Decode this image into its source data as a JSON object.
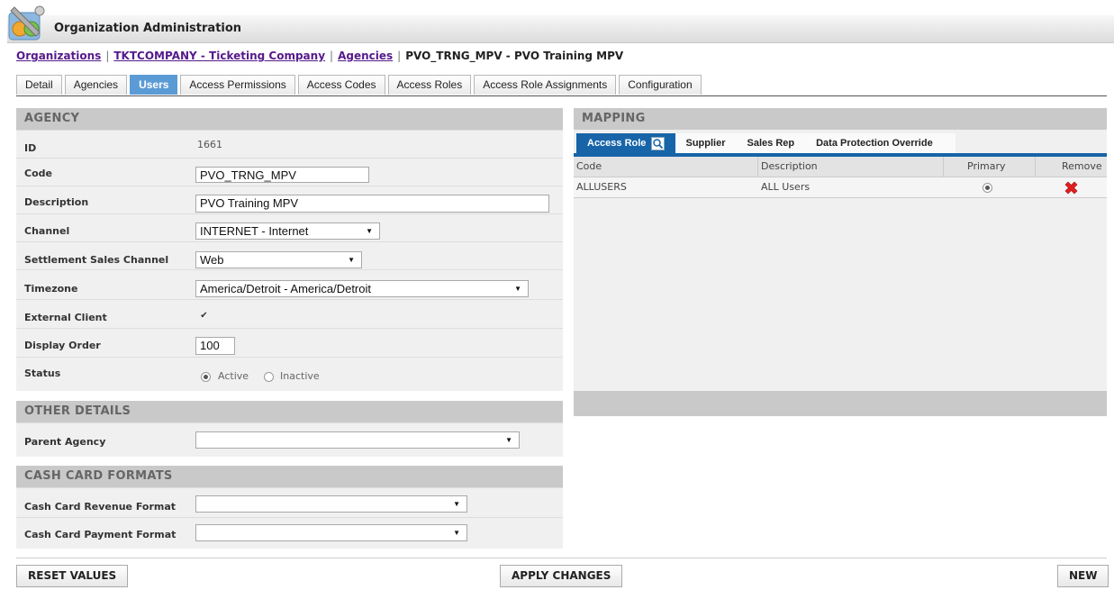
{
  "header": {
    "title": "Organization Administration",
    "logo_icon": "admin-tools-icon"
  },
  "breadcrumb": {
    "items": [
      "Organizations",
      "TKTCOMPANY - Ticketing Company",
      "Agencies"
    ],
    "current": "PVO_TRNG_MPV - PVO Training MPV"
  },
  "tabs": [
    {
      "label": "Detail"
    },
    {
      "label": "Agencies"
    },
    {
      "label": "Users"
    },
    {
      "label": "Access Permissions"
    },
    {
      "label": "Access Codes"
    },
    {
      "label": "Access Roles"
    },
    {
      "label": "Access Role Assignments"
    },
    {
      "label": "Configuration"
    }
  ],
  "active_tab": "Users",
  "agency": {
    "header": "AGENCY",
    "id_label": "ID",
    "id_value": "1661",
    "code_label": "Code",
    "code_value": "PVO_TRNG_MPV",
    "description_label": "Description",
    "description_value": "PVO Training MPV",
    "channel_label": "Channel",
    "channel_value": "INTERNET - Internet",
    "settlement_label": "Settlement Sales Channel",
    "settlement_value": "Web",
    "timezone_label": "Timezone",
    "timezone_value": "America/Detroit - America/Detroit",
    "external_label": "External Client",
    "external_checked": true,
    "display_order_label": "Display Order",
    "display_order_value": "100",
    "status_label": "Status",
    "status_active": "Active",
    "status_inactive": "Inactive",
    "status_selected": "Active"
  },
  "other": {
    "header": "OTHER DETAILS",
    "parent_label": "Parent Agency",
    "parent_value": ""
  },
  "cash": {
    "header": "CASH CARD FORMATS",
    "revenue_label": "Cash Card Revenue Format",
    "revenue_value": "",
    "payment_label": "Cash Card Payment Format",
    "payment_value": ""
  },
  "mapping": {
    "header": "MAPPING",
    "subtabs": [
      "Access Role",
      "Supplier",
      "Sales Rep",
      "Data Protection Override"
    ],
    "columns": [
      "Code",
      "Description",
      "Primary",
      "Remove"
    ],
    "rows": [
      {
        "code": "ALLUSERS",
        "description": "ALL Users",
        "primary": true
      }
    ]
  },
  "buttons": {
    "reset": "RESET VALUES",
    "apply": "APPLY CHANGES",
    "new": "NEW"
  },
  "colors": {
    "tab_active": "#5b9bd5",
    "subtab_active": "#1764a8",
    "remove": "#e02020",
    "link": "#551a8b"
  }
}
